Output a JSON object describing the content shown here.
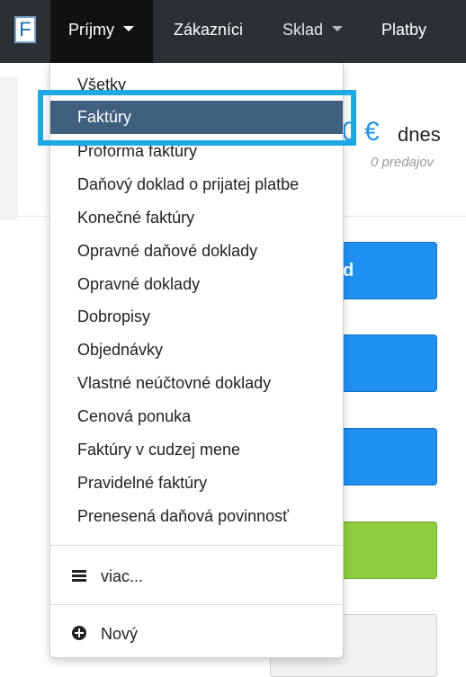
{
  "navbar": {
    "logo_letter": "F",
    "items": [
      {
        "label": "Príjmy",
        "active": true,
        "has_caret": true
      },
      {
        "label": "Zákazníci",
        "active": false,
        "has_caret": false
      },
      {
        "label": "Sklad",
        "active": false,
        "has_caret": true
      },
      {
        "label": "Platby",
        "active": false,
        "has_caret": false
      }
    ]
  },
  "background": {
    "amount": "0 €",
    "period": "dnes",
    "sales_count": "0 predajov",
    "button_partial_label": "d"
  },
  "dropdown": {
    "selected_index": 1,
    "items": [
      "Všetky",
      "Faktúry",
      "Proforma faktúry",
      "Daňový doklad o prijatej platbe",
      "Konečné faktúry",
      "Opravné daňové doklady",
      "Opravné doklady",
      "Dobropisy",
      "Objednávky",
      "Vlastné neúčtovné doklady",
      "Cenová ponuka",
      "Faktúry v cudzej mene",
      "Pravidelné faktúry",
      "Prenesená daňová povinnosť"
    ],
    "more_label": "viac...",
    "new_label": "Nový"
  },
  "colors": {
    "navbar_bg": "#2b3035",
    "active_nav_bg": "#111111",
    "selected_item_bg": "#3f5f7e",
    "highlight_border": "#1da8e6",
    "primary_button": "#1f8ff0",
    "success_button": "#8fcc3f",
    "amount_text": "#2a94e0"
  }
}
